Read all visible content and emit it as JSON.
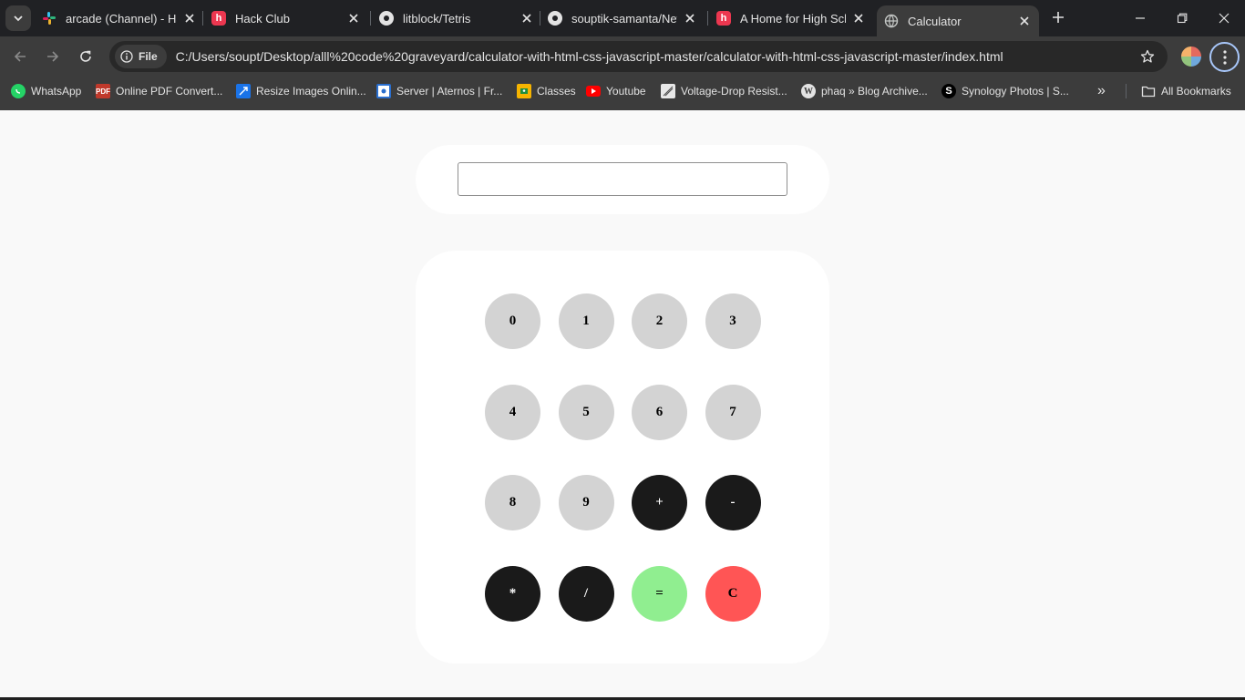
{
  "tabs": [
    {
      "title": "arcade (Channel) - Ha",
      "icon": "slack-icon"
    },
    {
      "title": "Hack Club",
      "icon": "hackclub-icon"
    },
    {
      "title": "litblock/Tetris",
      "icon": "github-icon"
    },
    {
      "title": "souptik-samanta/New",
      "icon": "github-icon"
    },
    {
      "title": "A Home for High Sch",
      "icon": "hackclub-icon"
    },
    {
      "title": "Calculator",
      "icon": "globe-icon",
      "active": true
    }
  ],
  "toolbar": {
    "chip_label": "File",
    "url": "C:/Users/soupt/Desktop/alll%20code%20graveyard/calculator-with-html-css-javascript-master/calculator-with-html-css-javascript-master/index.html"
  },
  "bookmarks": {
    "items": [
      {
        "label": "WhatsApp",
        "icon": "whatsapp-icon"
      },
      {
        "label": "Online PDF Convert...",
        "icon": "pdf-icon",
        "icon_text": "PDF"
      },
      {
        "label": "Resize Images Onlin...",
        "icon": "resize-icon"
      },
      {
        "label": "Server | Aternos | Fr...",
        "icon": "aternos-icon"
      },
      {
        "label": "Classes",
        "icon": "classroom-icon"
      },
      {
        "label": "Youtube",
        "icon": "youtube-icon"
      },
      {
        "label": "Voltage-Drop Resist...",
        "icon": "voltage-icon"
      },
      {
        "label": "phaq » Blog Archive...",
        "icon": "wordpress-icon"
      },
      {
        "label": "Synology Photos | S...",
        "icon": "synology-icon",
        "icon_text": "S"
      }
    ],
    "overflow": "»",
    "all_bookmarks": "All Bookmarks"
  },
  "calculator": {
    "display_value": "",
    "keys": [
      "0",
      "1",
      "2",
      "3",
      "4",
      "5",
      "6",
      "7",
      "8",
      "9",
      "+",
      "-",
      "*",
      "/",
      "=",
      "C"
    ]
  },
  "colors": {
    "digit_key": "#d3d3d3",
    "operator_key": "#1a1a1a",
    "equals_key": "#90ee90",
    "clear_key": "#ff5555",
    "page_background": "#f9f9f9",
    "card_background": "#ffffff"
  }
}
